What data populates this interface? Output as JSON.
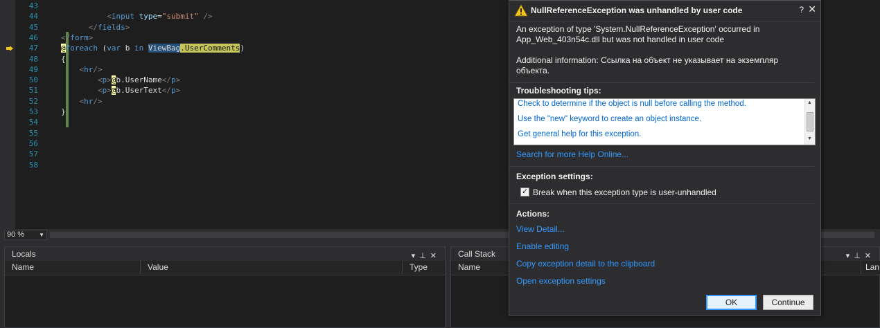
{
  "editor": {
    "lines": [
      {
        "num": "43",
        "tokens": []
      },
      {
        "num": "44",
        "tokens": [
          {
            "t": "          ",
            "c": "t-plain"
          },
          {
            "t": "<",
            "c": "t-tag"
          },
          {
            "t": "input",
            "c": "t-el"
          },
          {
            "t": " ",
            "c": "t-plain"
          },
          {
            "t": "type",
            "c": "t-attr"
          },
          {
            "t": "=",
            "c": "t-plain"
          },
          {
            "t": "\"submit\"",
            "c": "t-str"
          },
          {
            "t": " />",
            "c": "t-tag"
          }
        ]
      },
      {
        "num": "45",
        "tokens": [
          {
            "t": "      ",
            "c": "t-plain"
          },
          {
            "t": "</",
            "c": "t-tag"
          },
          {
            "t": "fields",
            "c": "t-el"
          },
          {
            "t": ">",
            "c": "t-tag"
          }
        ]
      },
      {
        "num": "46",
        "tokens": [
          {
            "t": "</",
            "c": "t-tag"
          },
          {
            "t": "form",
            "c": "t-el"
          },
          {
            "t": ">",
            "c": "t-tag"
          }
        ]
      },
      {
        "num": "47",
        "tokens": [
          {
            "t": "@",
            "c": "t-razor"
          },
          {
            "t": "foreach",
            "c": "t-kw"
          },
          {
            "t": " (",
            "c": "t-plain"
          },
          {
            "t": "var",
            "c": "t-kw"
          },
          {
            "t": " b ",
            "c": "t-plain"
          },
          {
            "t": "in",
            "c": "t-kw"
          },
          {
            "t": " ",
            "c": "t-plain"
          },
          {
            "t": "ViewBag",
            "c": "t-sel"
          },
          {
            "t": ".UserComments",
            "c": "t-hl"
          },
          {
            "t": ")",
            "c": "t-plain"
          }
        ]
      },
      {
        "num": "48",
        "tokens": [
          {
            "t": "{",
            "c": "t-plain"
          }
        ]
      },
      {
        "num": "49",
        "tokens": [
          {
            "t": "    ",
            "c": "t-plain"
          },
          {
            "t": "<",
            "c": "t-tag"
          },
          {
            "t": "hr",
            "c": "t-el"
          },
          {
            "t": "/>",
            "c": "t-tag"
          }
        ]
      },
      {
        "num": "50",
        "tokens": [
          {
            "t": "        ",
            "c": "t-plain"
          },
          {
            "t": "<",
            "c": "t-tag"
          },
          {
            "t": "p",
            "c": "t-el"
          },
          {
            "t": ">",
            "c": "t-tag"
          },
          {
            "t": "@",
            "c": "t-razor"
          },
          {
            "t": "b.UserName",
            "c": "t-plain"
          },
          {
            "t": "</",
            "c": "t-tag"
          },
          {
            "t": "p",
            "c": "t-el"
          },
          {
            "t": ">",
            "c": "t-tag"
          }
        ]
      },
      {
        "num": "51",
        "tokens": [
          {
            "t": "        ",
            "c": "t-plain"
          },
          {
            "t": "<",
            "c": "t-tag"
          },
          {
            "t": "p",
            "c": "t-el"
          },
          {
            "t": ">",
            "c": "t-tag"
          },
          {
            "t": "@",
            "c": "t-razor"
          },
          {
            "t": "b.UserText",
            "c": "t-plain"
          },
          {
            "t": "</",
            "c": "t-tag"
          },
          {
            "t": "p",
            "c": "t-el"
          },
          {
            "t": ">",
            "c": "t-tag"
          }
        ]
      },
      {
        "num": "52",
        "tokens": [
          {
            "t": "    ",
            "c": "t-plain"
          },
          {
            "t": "<",
            "c": "t-tag"
          },
          {
            "t": "hr",
            "c": "t-el"
          },
          {
            "t": "/>",
            "c": "t-tag"
          }
        ]
      },
      {
        "num": "53",
        "tokens": [
          {
            "t": "}",
            "c": "t-plain"
          }
        ]
      },
      {
        "num": "54",
        "tokens": []
      },
      {
        "num": "55",
        "tokens": []
      },
      {
        "num": "56",
        "tokens": []
      },
      {
        "num": "57",
        "tokens": []
      },
      {
        "num": "58",
        "tokens": []
      }
    ]
  },
  "zoom": {
    "value": "90 %"
  },
  "locals": {
    "title": "Locals",
    "columns": [
      "Name",
      "Value",
      "Type"
    ]
  },
  "callstack": {
    "title": "Call Stack",
    "columns": [
      "Name",
      "Lan"
    ]
  },
  "dialog": {
    "title": "NullReferenceException was unhandled by user code",
    "help": "?",
    "close": "✕",
    "message_line1": "An exception of type 'System.NullReferenceException' occurred in",
    "message_line2": "App_Web_403n54c.dll but was not handled in user code",
    "additional_line1": "Additional information: Ссылка на объект не указывает на экземпляр",
    "additional_line2": "объекта.",
    "tips_header": "Troubleshooting tips:",
    "tips": [
      "Check to determine if the object is null before calling the method.",
      "Use the \"new\" keyword to create an object instance.",
      "Get general help for this exception."
    ],
    "search_online": "Search for more Help Online...",
    "settings_header": "Exception settings:",
    "break_checkbox_label": "Break when this exception type is user-unhandled",
    "break_checked": true,
    "actions_header": "Actions:",
    "actions": [
      "View Detail...",
      "Enable editing",
      "Copy exception detail to the clipboard",
      "Open exception settings"
    ],
    "ok_label": "OK",
    "continue_label": "Continue"
  },
  "colors": {
    "editor_bg": "#1e1e1e",
    "line_number": "#2b91af",
    "keyword": "#569cd6",
    "link": "#3399ff",
    "warning": "#f5c518"
  }
}
